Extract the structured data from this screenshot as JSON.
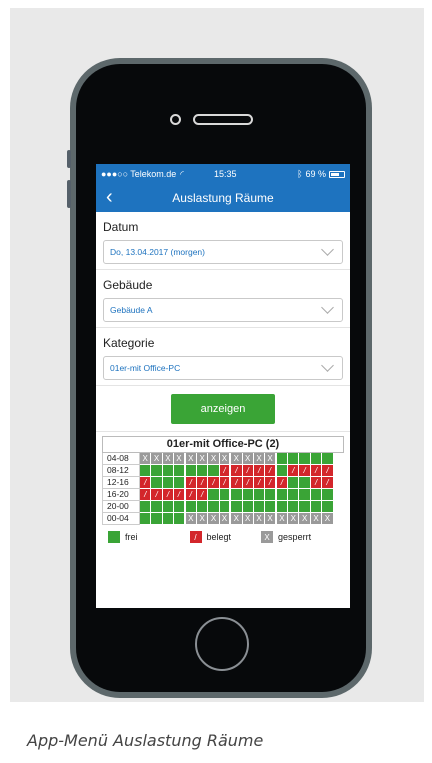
{
  "status_bar": {
    "signal": "●●●○○",
    "carrier": "Telekom.de",
    "wifi": "wifi-icon",
    "time": "15:35",
    "bluetooth": "bluetooth-icon",
    "battery": "69 %"
  },
  "nav": {
    "back_icon": "chevron-left-icon",
    "title": "Auslastung Räume"
  },
  "form": {
    "date": {
      "label": "Datum",
      "value": "Do, 13.04.2017 (morgen)"
    },
    "building": {
      "label": "Gebäude",
      "value": "Gebäude A"
    },
    "category": {
      "label": "Kategorie",
      "value": "01er-mit Office-PC"
    }
  },
  "show_button": "anzeigen",
  "occupancy": {
    "title": "01er-mit Office-PC (2)",
    "slots": [
      "04-08",
      "08-12",
      "12-16",
      "16-20",
      "20-00",
      "00-04"
    ],
    "rows": [
      [
        "x",
        "x",
        "x",
        "x",
        "x",
        "x",
        "x",
        "x",
        "x",
        "x",
        "x",
        "x",
        "f",
        "f",
        "f",
        "f",
        "f"
      ],
      [
        "f",
        "f",
        "f",
        "f",
        "f",
        "f",
        "f",
        "/",
        "/",
        "/",
        "/",
        "/",
        "f",
        "/",
        "/",
        "/",
        "/"
      ],
      [
        "/",
        "f",
        "f",
        "f",
        "/",
        "/",
        "/",
        "/",
        "/",
        "/",
        "/",
        "/",
        "/",
        "f",
        "f",
        "/",
        "/"
      ],
      [
        "/",
        "/",
        "/",
        "/",
        "/",
        "/",
        "f",
        "f",
        "f",
        "f",
        "f",
        "f",
        "f",
        "f",
        "f",
        "f",
        "f"
      ],
      [
        "f",
        "f",
        "f",
        "f",
        "f",
        "f",
        "f",
        "f",
        "f",
        "f",
        "f",
        "f",
        "f",
        "f",
        "f",
        "f",
        "f"
      ],
      [
        "f",
        "f",
        "f",
        "f",
        "x",
        "x",
        "x",
        "x",
        "x",
        "x",
        "x",
        "x",
        "x",
        "x",
        "x",
        "x",
        "x"
      ]
    ],
    "marks": {
      "x": "X",
      "/": "/"
    }
  },
  "legend": [
    {
      "code": "f",
      "mark": "",
      "label": "frei"
    },
    {
      "code": "b",
      "mark": "/",
      "label": "belegt"
    },
    {
      "code": "g",
      "mark": "X",
      "label": "gesperrt"
    }
  ],
  "colors": {
    "header_blue": "#1e73bf",
    "free_green": "#3aa436",
    "occupied_red": "#d3262b",
    "blocked_grey": "#9a9a9a"
  },
  "caption": "App-Menü Auslastung Räume"
}
